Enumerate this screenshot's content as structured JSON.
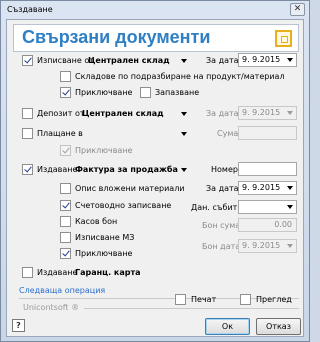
{
  "window": {
    "title": "Създаване",
    "close_glyph": "✕"
  },
  "header": {
    "title": "Свързани документи",
    "logo_icon": "document-link-icon"
  },
  "issue_from": {
    "label": "Изписване от",
    "warehouse": "Централен склад",
    "date_label": "За дата:",
    "date": "9. 9.2015",
    "checked": true
  },
  "warehouse_option": {
    "label": "Складове по подразбиране на продукт/материал",
    "checked": false
  },
  "posting": {
    "label": "Приключване",
    "checked": true
  },
  "reserve": {
    "label": "Запазване",
    "checked": false
  },
  "deposit": {
    "label": "Депозит от",
    "warehouse": "Централен склад",
    "date_label": "За дата:",
    "date": "9. 9.2015",
    "checked": false
  },
  "payment": {
    "label": "Плащане в",
    "sum_label": "Сума:",
    "sum": "",
    "checked": false
  },
  "payment_posting": {
    "label": "Приключване",
    "checked": true
  },
  "invoice": {
    "label": "Издаване",
    "doc_type": "Фактура за продажба",
    "number_label": "Номер:",
    "number": "",
    "checked": true
  },
  "description": {
    "label": "Опис вложени материали",
    "checked": false,
    "date_label": "За дата:",
    "date": "9. 9.2015"
  },
  "accounting": {
    "label": "Счетоводно записване",
    "checked": true,
    "tax_event_label": "Дан. събитие:",
    "tax_event": ""
  },
  "cash_receipt": {
    "label": "Касов бон",
    "checked": false,
    "receipt_sum_label": "Бон сума:",
    "receipt_sum": "0.00"
  },
  "issue_mz": {
    "label": "Изписване МЗ",
    "checked": false
  },
  "invoice_posting": {
    "label": "Приключване",
    "checked": true,
    "receipt_date_label": "Бон дата:",
    "receipt_date": "9. 9.2015"
  },
  "warranty": {
    "label": "Издаване",
    "doc_type": "Гаранц. карта",
    "checked": false
  },
  "next_operation": "Следваща операция",
  "brand": "Unicontsoft ®",
  "print": {
    "label": "Печат",
    "checked": false
  },
  "preview": {
    "label": "Преглед",
    "checked": false
  },
  "buttons": {
    "ok": "Ок",
    "cancel": "Отказ",
    "help_glyph": "?"
  }
}
